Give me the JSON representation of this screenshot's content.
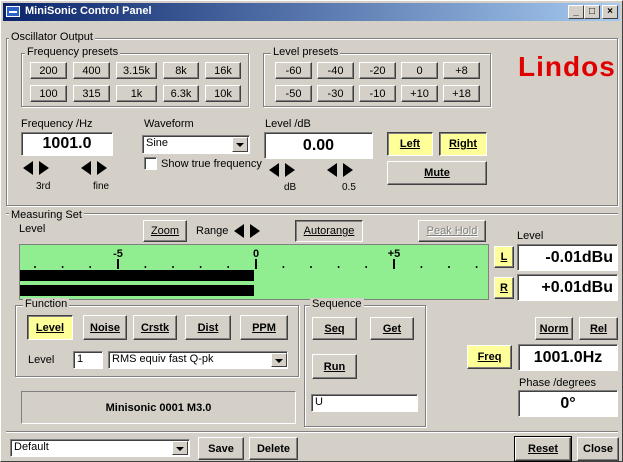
{
  "window": {
    "title": "MiniSonic Control Panel",
    "min_btn": "_",
    "max_btn": "□",
    "close_btn": "×"
  },
  "brand": {
    "logo": "Lindos",
    "color": "#e00000"
  },
  "oscillator": {
    "group_label": "Oscillator Output",
    "freq_presets_label": "Frequency presets",
    "freq_presets_row1": [
      "200",
      "400",
      "3.15k",
      "8k",
      "16k"
    ],
    "freq_presets_row2": [
      "100",
      "315",
      "1k",
      "6.3k",
      "10k"
    ],
    "level_presets_label": "Level presets",
    "level_presets_row1": [
      "-60",
      "-40",
      "-20",
      "0",
      "+8"
    ],
    "level_presets_row2": [
      "-50",
      "-30",
      "-10",
      "+10",
      "+18"
    ],
    "frequency_label": "Frequency /Hz",
    "frequency_value": "1001.0",
    "freq_step_coarse_label": "3rd",
    "freq_step_fine_label": "fine",
    "waveform_label": "Waveform",
    "waveform_value": "Sine",
    "show_true_freq_label": "Show true frequency",
    "level_label": "Level /dB",
    "level_value": "0.00",
    "level_step_db_label": "dB",
    "level_step_half_label": "0.5",
    "left_btn": "Left",
    "right_btn": "Right",
    "mute_btn": "Mute"
  },
  "measuring": {
    "group_label": "Measuring Set",
    "level_label": "Level",
    "zoom_btn": "Zoom",
    "range_label": "Range",
    "autorange_btn": "Autorange",
    "peak_hold_btn": "Peak Hold",
    "scale_labels": [
      "-5",
      "0",
      "+5"
    ],
    "meter_fraction_left": 0.5,
    "meter_fraction_right": 0.5,
    "meter_color": "#90ee90",
    "right_level_label": "Level",
    "ch_l_btn": "L",
    "ch_r_btn": "R",
    "level_l_value": "-0.01dBu",
    "level_r_value": "+0.01dBu",
    "norm_btn": "Norm",
    "rel_btn": "Rel",
    "freq_btn": "Freq",
    "freq_value": "1001.0Hz",
    "phase_label": "Phase /degrees",
    "phase_value": "0°"
  },
  "function": {
    "group_label": "Function",
    "buttons": [
      "Level",
      "Noise",
      "Crstk",
      "Dist",
      "PPM"
    ],
    "level_field_label": "Level",
    "level_field_value": "1",
    "detector_value": "RMS equiv fast Q-pk",
    "device_status": "Minisonic 0001 M3.0"
  },
  "sequence": {
    "group_label": "Sequence",
    "seq_btn": "Seq",
    "get_btn": "Get",
    "run_btn": "Run",
    "input_value": "U"
  },
  "footer": {
    "preset_value": "Default",
    "save_btn": "Save",
    "delete_btn": "Delete",
    "reset_btn": "Reset",
    "close_btn": "Close"
  }
}
